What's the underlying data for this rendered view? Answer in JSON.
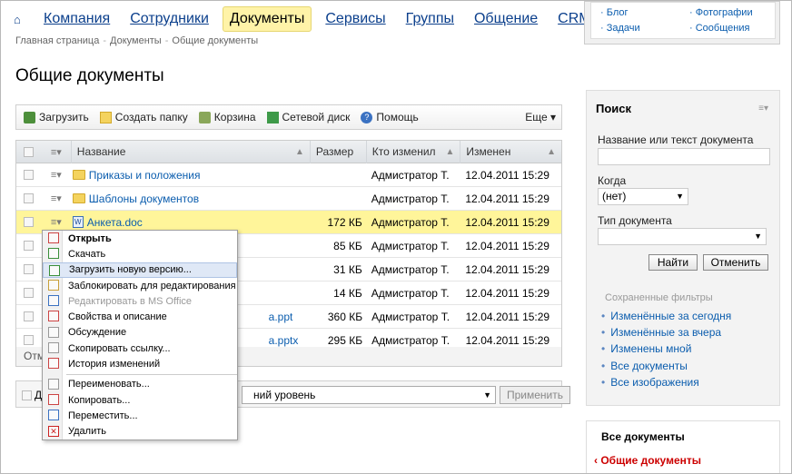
{
  "nav": {
    "items": [
      {
        "label": "Компания",
        "active": false
      },
      {
        "label": "Сотрудники",
        "active": false
      },
      {
        "label": "Документы",
        "active": true
      },
      {
        "label": "Сервисы",
        "active": false
      },
      {
        "label": "Группы",
        "active": false
      },
      {
        "label": "Общение",
        "active": false
      },
      {
        "label": "CRM",
        "active": false
      }
    ]
  },
  "breadcrumb": [
    "Главная страница",
    "Документы",
    "Общие документы"
  ],
  "page_title": "Общие документы",
  "toolbar": {
    "upload": "Загрузить",
    "new_folder": "Создать папку",
    "trash": "Корзина",
    "network_drive": "Сетевой диск",
    "help": "Помощь",
    "more": "Еще"
  },
  "grid": {
    "columns": {
      "name": "Название",
      "size": "Размер",
      "who": "Кто изменил",
      "date": "Изменен"
    },
    "rows": [
      {
        "type": "folder",
        "name": "Приказы и положения",
        "size": "",
        "who": "Адмистратор Т.",
        "date": "12.04.2011 15:29"
      },
      {
        "type": "folder",
        "name": "Шаблоны документов",
        "size": "",
        "who": "Адмистратор Т.",
        "date": "12.04.2011 15:29"
      },
      {
        "type": "doc",
        "name": "Анкета.doc",
        "size": "172 КБ",
        "who": "Адмистратор Т.",
        "date": "12.04.2011 15:29"
      },
      {
        "type": "doc",
        "name": "",
        "size": "85 КБ",
        "who": "Адмистратор Т.",
        "date": "12.04.2011 15:29"
      },
      {
        "type": "doc",
        "name": "",
        "size": "31 КБ",
        "who": "Адмистратор Т.",
        "date": "12.04.2011 15:29"
      },
      {
        "type": "doc",
        "name": "",
        "size": "14 КБ",
        "who": "Адмистратор Т.",
        "date": "12.04.2011 15:29"
      },
      {
        "type": "doc",
        "name": "a.ppt",
        "size": "360 КБ",
        "who": "Адмистратор Т.",
        "date": "12.04.2011 15:29"
      },
      {
        "type": "doc",
        "name": "a.pptx",
        "size": "295 КБ",
        "who": "Адмистратор Т.",
        "date": "12.04.2011 15:29"
      }
    ],
    "footer": "Отм"
  },
  "actbar": {
    "label": "Д",
    "select_value": "ний уровень",
    "apply": "Применить"
  },
  "context_menu": [
    {
      "label": "Открыть",
      "bold": true
    },
    {
      "label": "Скачать"
    },
    {
      "label": "Загрузить новую версию...",
      "highlight": true
    },
    {
      "label": "Заблокировать для редактирования"
    },
    {
      "label": "Редактировать в MS Office",
      "disabled": true
    },
    {
      "label": "Свойства и описание"
    },
    {
      "label": "Обсуждение"
    },
    {
      "label": "Скопировать ссылку..."
    },
    {
      "label": "История изменений"
    },
    {
      "sep": true
    },
    {
      "label": "Переименовать..."
    },
    {
      "label": "Копировать..."
    },
    {
      "label": "Переместить..."
    },
    {
      "label": "Удалить"
    }
  ],
  "top_right": {
    "blog": "Блог",
    "tasks": "Задачи",
    "photos": "Фотографии",
    "messages": "Сообщения"
  },
  "search": {
    "title": "Поиск",
    "name_label": "Название или текст документа",
    "when_label": "Когда",
    "when_value": "(нет)",
    "type_label": "Тип документа",
    "find": "Найти",
    "cancel": "Отменить",
    "saved_filters": "Сохраненные фильтры",
    "filters": [
      "Изменённые за сегодня",
      "Изменённые за вчера",
      "Изменены мной",
      "Все документы",
      "Все изображения"
    ]
  },
  "all_docs": {
    "title": "Все документы",
    "current": "Общие документы"
  }
}
